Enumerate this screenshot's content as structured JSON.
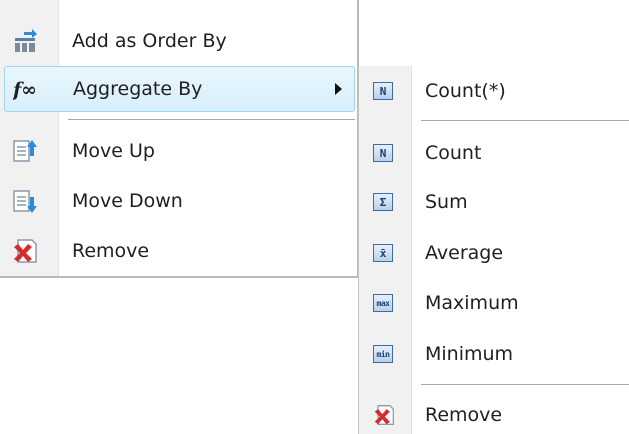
{
  "context_menu": {
    "items": [
      {
        "label": "Add as Order By",
        "icon": "order-by-icon"
      },
      {
        "label": "Aggregate By",
        "icon": "function-icon",
        "has_submenu": true,
        "highlighted": true
      },
      {
        "label": "Move Up",
        "icon": "move-up-icon"
      },
      {
        "label": "Move Down",
        "icon": "move-down-icon"
      },
      {
        "label": "Remove",
        "icon": "remove-icon"
      }
    ]
  },
  "submenu": {
    "items": [
      {
        "label": "Count(*)",
        "icon": "count-icon",
        "badge": "N"
      },
      {
        "label": "Count",
        "icon": "count-icon",
        "badge": "N"
      },
      {
        "label": "Sum",
        "icon": "sum-icon",
        "badge": "Σ"
      },
      {
        "label": "Average",
        "icon": "average-icon",
        "badge": "x̄"
      },
      {
        "label": "Maximum",
        "icon": "max-icon",
        "badge": "max"
      },
      {
        "label": "Minimum",
        "icon": "min-icon",
        "badge": "min"
      },
      {
        "label": "Remove",
        "icon": "remove-icon"
      }
    ]
  },
  "colors": {
    "highlight_fill": "#d7effc",
    "highlight_border": "#9fd5f3",
    "gutter": "#f1f1f1",
    "badge_blue": "#3b6ea8",
    "remove_red": "#d62b2b"
  },
  "function_glyph": "f∞"
}
